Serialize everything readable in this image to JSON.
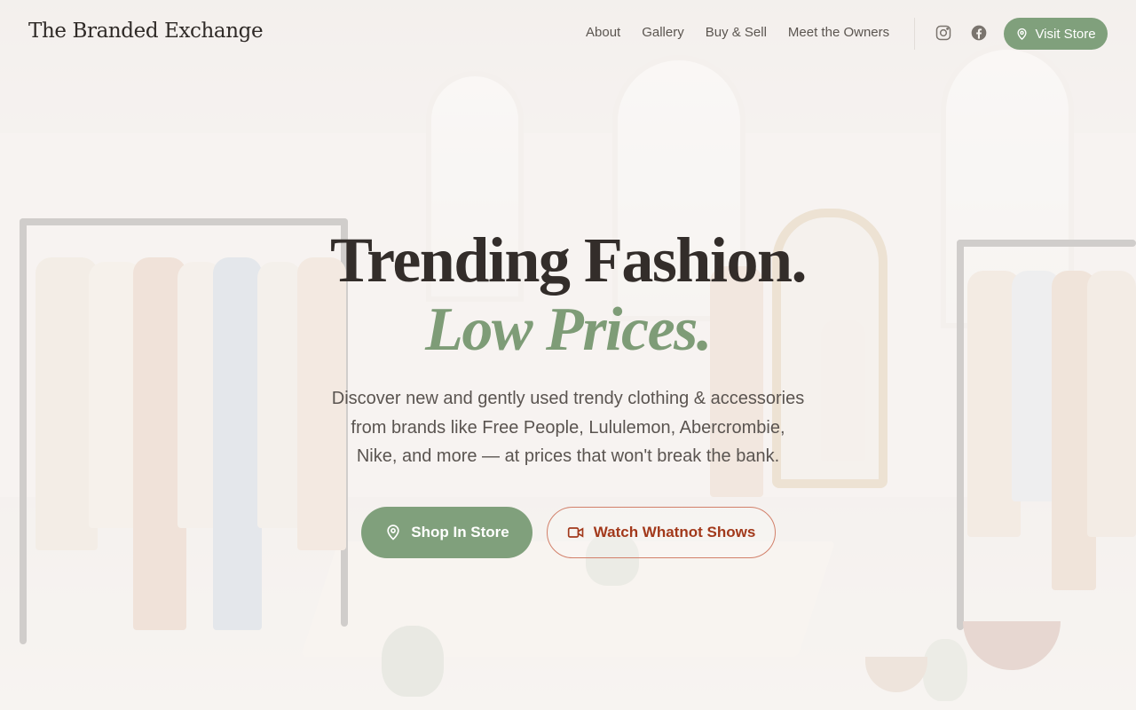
{
  "header": {
    "brand": "The Branded Exchange",
    "nav": [
      {
        "label": "About"
      },
      {
        "label": "Gallery"
      },
      {
        "label": "Buy & Sell"
      },
      {
        "label": "Meet the Owners"
      }
    ],
    "social_icons": [
      "instagram-icon",
      "facebook-icon"
    ],
    "visit_button": {
      "label": "Visit Store",
      "icon": "map-pin-icon"
    }
  },
  "hero": {
    "title_line1": "Trending Fashion.",
    "title_line2": "Low Prices.",
    "subtitle": "Discover new and gently used trendy clothing & accessories from brands like Free People, Lululemon, Abercrombie, Nike, and more — at prices that won't break the bank.",
    "primary_cta": {
      "label": "Shop In Store",
      "icon": "map-pin-icon"
    },
    "secondary_cta": {
      "label": "Watch Whatnot Shows",
      "icon": "video-camera-icon"
    }
  },
  "colors": {
    "accent_green": "#80a07c",
    "accent_rust": "#a2391b",
    "title_dark": "#332d2a"
  }
}
